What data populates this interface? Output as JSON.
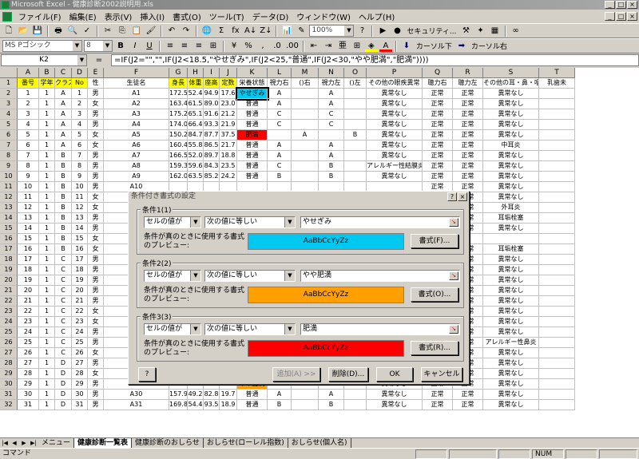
{
  "window": {
    "title": "Microsoft Excel - 健康診断2002説明用.xls"
  },
  "menu": [
    "ファイル(F)",
    "編集(E)",
    "表示(V)",
    "挿入(I)",
    "書式(O)",
    "ツール(T)",
    "データ(D)",
    "ウィンドウ(W)",
    "ヘルプ(H)"
  ],
  "toolbar": {
    "zoom": "100%",
    "security": "セキュリティ...",
    "font": "MS Pゴシック",
    "size": "8",
    "cursor_down": "カーソル下",
    "cursor_right": "カーソル右"
  },
  "formula_bar": {
    "cell": "K2",
    "eq": "=",
    "formula": "=IF(J2=\"\",\"\",IF(J2<18.5,\"やせぎみ\",IF(J2<25,\"普通\",IF(J2<30,\"やや肥満\",\"肥満\"))))"
  },
  "columns": [
    "A",
    "B",
    "C",
    "D",
    "E",
    "F",
    "G",
    "H",
    "I",
    "J",
    "K",
    "L",
    "M",
    "N",
    "O",
    "P",
    "Q",
    "R",
    "S",
    "T"
  ],
  "headers": [
    "番号",
    "学年",
    "クラス",
    "No",
    "性",
    "生徒名",
    "身長",
    "体重",
    "座高",
    "定数",
    "栄養状態",
    "視力右",
    "()右",
    "視力左",
    "()左",
    "その他の眼疾異常",
    "聴力右",
    "聴力左",
    "その他の耳・鼻・咽疾患",
    "乳歯未"
  ],
  "rows": [
    [
      "1",
      "1",
      "A",
      "1",
      "男",
      "A1",
      "172.5",
      "52.4",
      "94.9",
      "17.6",
      "やせぎみ",
      "A",
      "",
      "A",
      "",
      "異常なし",
      "正常",
      "正常",
      "異常なし",
      ""
    ],
    [
      "2",
      "1",
      "A",
      "2",
      "女",
      "A2",
      "163.4",
      "61.5",
      "89.0",
      "23.0",
      "普通",
      "A",
      "",
      "A",
      "",
      "異常なし",
      "正常",
      "正常",
      "異常なし",
      ""
    ],
    [
      "3",
      "1",
      "A",
      "3",
      "男",
      "A3",
      "175.2",
      "65.1",
      "91.6",
      "21.2",
      "普通",
      "C",
      "",
      "C",
      "",
      "異常なし",
      "正常",
      "正常",
      "異常なし",
      ""
    ],
    [
      "4",
      "1",
      "A",
      "4",
      "男",
      "A4",
      "174.0",
      "66.4",
      "93.3",
      "21.9",
      "普通",
      "C",
      "",
      "C",
      "",
      "異常なし",
      "正常",
      "正常",
      "異常なし",
      ""
    ],
    [
      "5",
      "1",
      "A",
      "5",
      "女",
      "A5",
      "150.2",
      "84.7",
      "87.7",
      "37.5",
      "肥満",
      "",
      "A",
      "",
      "B",
      "異常なし",
      "正常",
      "正常",
      "異常なし",
      ""
    ],
    [
      "6",
      "1",
      "A",
      "6",
      "女",
      "A6",
      "160.4",
      "55.8",
      "86.5",
      "21.7",
      "普通",
      "A",
      "",
      "A",
      "",
      "異常なし",
      "正常",
      "正常",
      "中耳炎",
      ""
    ],
    [
      "7",
      "1",
      "B",
      "7",
      "男",
      "A7",
      "166.5",
      "52.0",
      "89.7",
      "18.8",
      "普通",
      "A",
      "",
      "A",
      "",
      "異常なし",
      "正常",
      "正常",
      "異常なし",
      ""
    ],
    [
      "8",
      "1",
      "B",
      "8",
      "男",
      "A8",
      "159.3",
      "59.6",
      "84.3",
      "23.5",
      "普通",
      "C",
      "",
      "B",
      "",
      "アレルギー性結膜炎",
      "正常",
      "正常",
      "異常なし",
      ""
    ],
    [
      "9",
      "1",
      "B",
      "9",
      "男",
      "A9",
      "162.0",
      "63.5",
      "85.2",
      "24.2",
      "普通",
      "B",
      "",
      "B",
      "",
      "異常なし",
      "正常",
      "正常",
      "異常なし",
      ""
    ],
    [
      "10",
      "1",
      "B",
      "10",
      "男",
      "A10",
      "",
      "",
      "",
      "",
      "",
      "",
      "",
      "",
      "",
      "",
      "正常",
      "正常",
      "異常なし",
      ""
    ],
    [
      "11",
      "1",
      "B",
      "11",
      "女",
      "A11",
      "",
      "",
      "",
      "",
      "",
      "",
      "",
      "",
      "",
      "",
      "正常",
      "正常",
      "異常なし",
      ""
    ],
    [
      "12",
      "1",
      "B",
      "12",
      "女",
      "A12",
      "",
      "",
      "",
      "",
      "",
      "",
      "",
      "",
      "",
      "",
      "正常",
      "正常",
      "外耳炎",
      ""
    ],
    [
      "13",
      "1",
      "B",
      "13",
      "男",
      "A13",
      "",
      "",
      "",
      "",
      "",
      "",
      "",
      "",
      "",
      "",
      "正常",
      "正常",
      "耳垢栓塞",
      ""
    ],
    [
      "14",
      "1",
      "B",
      "14",
      "男",
      "A14",
      "",
      "",
      "",
      "",
      "",
      "",
      "",
      "",
      "",
      "",
      "正常",
      "正常",
      "異常なし",
      ""
    ],
    [
      "15",
      "1",
      "B",
      "15",
      "女",
      "A15",
      "",
      "",
      "",
      "",
      "",
      "",
      "",
      "",
      "",
      "",
      "",
      "",
      "",
      ""
    ],
    [
      "16",
      "1",
      "B",
      "16",
      "女",
      "A16",
      "",
      "",
      "",
      "",
      "",
      "",
      "",
      "",
      "",
      "",
      "正常",
      "正常",
      "耳垢栓塞",
      ""
    ],
    [
      "17",
      "1",
      "C",
      "17",
      "男",
      "A17",
      "",
      "",
      "",
      "",
      "",
      "",
      "",
      "",
      "",
      "",
      "正常",
      "正常",
      "異常なし",
      ""
    ],
    [
      "18",
      "1",
      "C",
      "18",
      "男",
      "A18",
      "",
      "",
      "",
      "",
      "",
      "",
      "",
      "",
      "",
      "",
      "正常",
      "正常",
      "異常なし",
      ""
    ],
    [
      "19",
      "1",
      "C",
      "19",
      "男",
      "A19",
      "",
      "",
      "",
      "",
      "",
      "",
      "",
      "",
      "",
      "",
      "正常",
      "正常",
      "異常なし",
      ""
    ],
    [
      "20",
      "1",
      "C",
      "20",
      "男",
      "A20",
      "",
      "",
      "",
      "",
      "",
      "",
      "",
      "",
      "",
      "",
      "両方",
      "正常",
      "異常なし",
      ""
    ],
    [
      "21",
      "1",
      "C",
      "21",
      "男",
      "A21",
      "",
      "",
      "",
      "",
      "",
      "",
      "",
      "",
      "",
      "",
      "正常",
      "正常",
      "異常なし",
      ""
    ],
    [
      "22",
      "1",
      "C",
      "22",
      "女",
      "A22",
      "",
      "",
      "",
      "",
      "",
      "",
      "",
      "",
      "",
      "",
      "正常",
      "正常",
      "異常なし",
      ""
    ],
    [
      "23",
      "1",
      "C",
      "23",
      "女",
      "A23",
      "",
      "",
      "",
      "",
      "",
      "",
      "",
      "",
      "",
      "",
      "正常",
      "正常",
      "異常なし",
      ""
    ],
    [
      "24",
      "1",
      "C",
      "24",
      "男",
      "A24",
      "",
      "",
      "",
      "",
      "",
      "",
      "",
      "",
      "",
      "",
      "正常",
      "正常",
      "異常なし",
      ""
    ],
    [
      "25",
      "1",
      "C",
      "25",
      "男",
      "A25",
      "",
      "",
      "",
      "",
      "",
      "",
      "",
      "",
      "",
      "",
      "正常",
      "正常",
      "アレルギー性鼻炎",
      ""
    ],
    [
      "26",
      "1",
      "C",
      "26",
      "女",
      "A26",
      "",
      "",
      "",
      "",
      "",
      "",
      "",
      "",
      "",
      "",
      "正常",
      "正常",
      "異常なし",
      ""
    ],
    [
      "27",
      "1",
      "D",
      "27",
      "男",
      "A27",
      "162.3",
      "52.7",
      "89.4",
      "20.0",
      "普通",
      "C",
      "",
      "B",
      "",
      "斜視",
      "正常",
      "正常",
      "異常なし",
      ""
    ],
    [
      "28",
      "1",
      "D",
      "28",
      "女",
      "A28",
      "154.2",
      "49.5",
      "85.3",
      "20.8",
      "普通",
      "A",
      "",
      "A",
      "",
      "異常なし",
      "正常",
      "正常",
      "異常なし",
      ""
    ],
    [
      "29",
      "1",
      "D",
      "29",
      "男",
      "A29",
      "170.4",
      "75.0",
      "95.7",
      "25.8",
      "やや肥満",
      "A",
      "",
      "A",
      "",
      "異常なし",
      "正常",
      "正常",
      "異常なし",
      ""
    ],
    [
      "30",
      "1",
      "D",
      "30",
      "男",
      "A30",
      "157.9",
      "49.2",
      "82.8",
      "19.7",
      "普通",
      "A",
      "",
      "A",
      "",
      "異常なし",
      "正常",
      "正常",
      "異常なし",
      ""
    ],
    [
      "31",
      "1",
      "D",
      "31",
      "男",
      "A31",
      "169.8",
      "54.4",
      "93.5",
      "18.9",
      "普通",
      "B",
      "",
      "B",
      "",
      "異常なし",
      "正常",
      "正常",
      "異常なし",
      ""
    ]
  ],
  "dialog": {
    "title": "条件付き書式の設定",
    "help": "?",
    "close": "×",
    "preview_label": "条件が真のときに使用する書式のプレビュー:",
    "preview_text": "AaBbCcYyZz",
    "conditions": [
      {
        "label": "条件1(1)",
        "type": "セルの値が",
        "op": "次の値に等しい",
        "value": "やせぎみ",
        "format_btn": "書式(F)...",
        "color": "#00c8f0"
      },
      {
        "label": "条件2(2)",
        "type": "セルの値が",
        "op": "次の値に等しい",
        "value": "やや肥満",
        "format_btn": "書式(O)...",
        "color": "#ffa000"
      },
      {
        "label": "条件3(3)",
        "type": "セルの値が",
        "op": "次の値に等しい",
        "value": "肥満",
        "format_btn": "書式(R)...",
        "color": "#ff0000"
      }
    ],
    "add": "追加(A) >>",
    "delete": "削除(D)...",
    "ok": "OK",
    "cancel": "キャンセル"
  },
  "tabs": [
    "メニュー",
    "健康診断一覧表",
    "健康診断のおしらせ",
    "おしらせ(ローレル指数)",
    "おしらせ(個人名)"
  ],
  "status": {
    "left": "コマンド",
    "num": "NUM"
  }
}
